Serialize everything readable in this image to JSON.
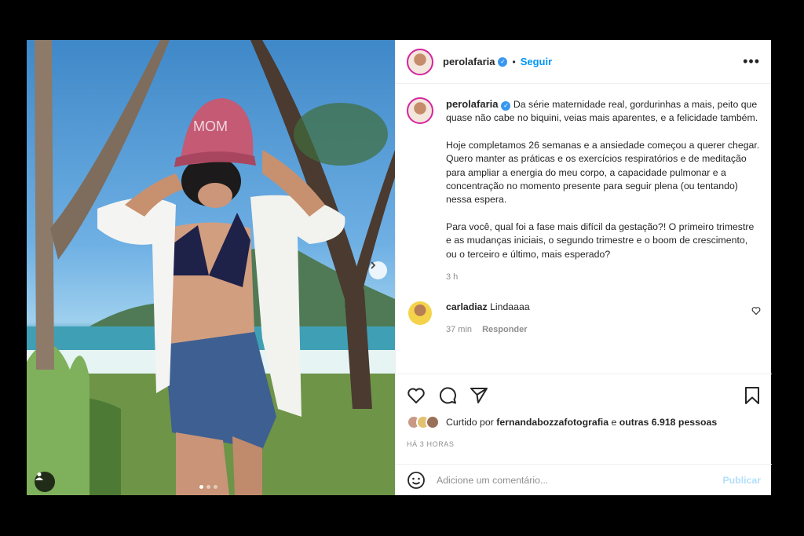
{
  "post": {
    "username": "perolafaria",
    "follow_label": "Seguir",
    "separator": "•",
    "more_label": "•••"
  },
  "caption": {
    "username": "perolafaria",
    "p1": "Da série maternidade real, gordurinhas a mais, peito que quase não cabe no biquini, veias mais aparentes, e a felicidade também.",
    "p2": "Hoje completamos 26 semanas e a ansiedade começou a querer chegar. Quero manter as práticas e os exercícios respiratórios e de meditação para ampliar a energia do meu corpo, a capacidade pulmonar e a concentração no momento presente para seguir plena (ou tentando) nessa espera.",
    "p3": "Para você, qual foi a fase mais difícil da gestação?! O primeiro trimestre e as mudanças iniciais, o segundo trimestre e o boom de crescimento, ou o terceiro e último, mais esperado?",
    "time": "3 h"
  },
  "comment": {
    "username": "carladiaz",
    "text": "Lindaaaa",
    "time": "37 min",
    "reply_label": "Responder"
  },
  "likes": {
    "prefix": "Curtido por",
    "liker": "fernandabozzafotografia",
    "connector": "e",
    "others": "outras 6.918 pessoas"
  },
  "timestamp": "HÁ 3 HORAS",
  "add_comment": {
    "placeholder": "Adicione um comentário...",
    "publish_label": "Publicar"
  },
  "photo": {
    "cap_text": "MOM"
  },
  "carousel": {
    "current": 1,
    "total": 3
  },
  "colors": {
    "link": "#0095f6",
    "publish_disabled": "#b2dffc",
    "verified": "#3897f0"
  }
}
